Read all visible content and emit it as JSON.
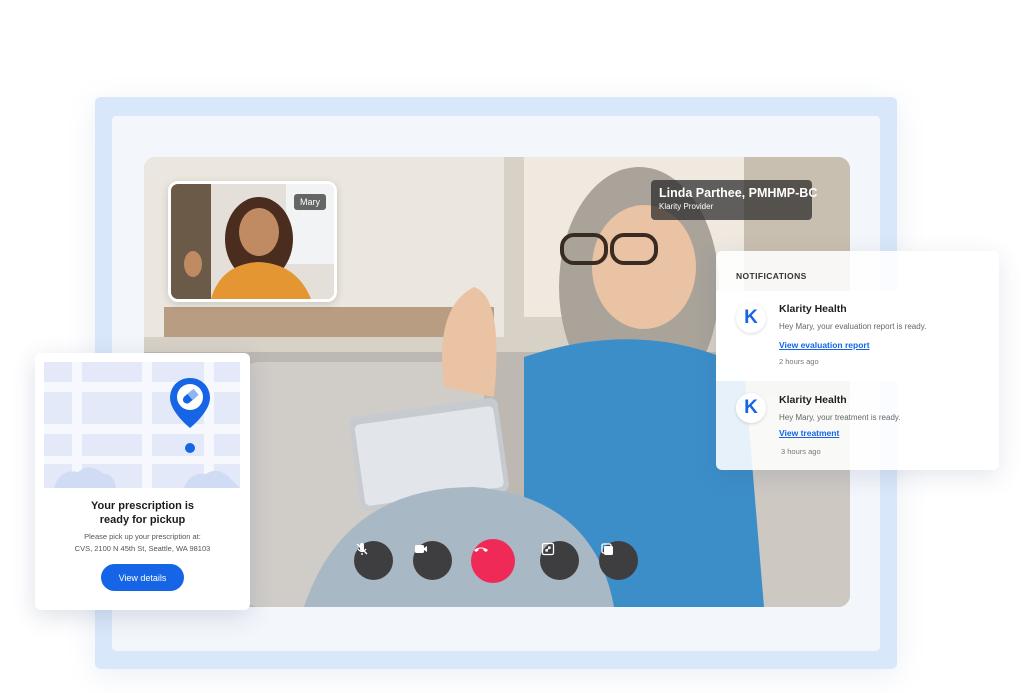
{
  "video": {
    "provider": {
      "name": "Linda Parthee, PMHMP-BC",
      "role": "Klarity Provider"
    },
    "self_view": {
      "name": "Mary"
    },
    "controls": [
      {
        "icon": "mic-off-icon"
      },
      {
        "icon": "camera-icon"
      },
      {
        "icon": "end-call-icon"
      },
      {
        "icon": "fullscreen-icon"
      },
      {
        "icon": "screen-share-icon"
      }
    ]
  },
  "prescription": {
    "title": "Your prescription is ready for pickup",
    "subtitle_line1": "Please pick up your prescription at:",
    "subtitle_line2": "CVS, 2100 N 45th St, Seattle, WA 98103",
    "button": "View details"
  },
  "notifications": {
    "heading": "NOTIFICATIONS",
    "items": [
      {
        "logo": "K",
        "title": "Klarity Health",
        "message": "Hey Mary, your evaluation report is ready.",
        "link": "View evaluation report",
        "time": "2 hours ago"
      },
      {
        "logo": "K",
        "title": "Klarity Health",
        "message": "Hey Mary, your treatment is ready.",
        "link": "View treatment",
        "time": "3 hours ago"
      }
    ]
  },
  "colors": {
    "accent": "#1565e6",
    "end_call": "#ef2a57",
    "frame": "#d9e7fa",
    "control_bg": "#3e3e40"
  }
}
